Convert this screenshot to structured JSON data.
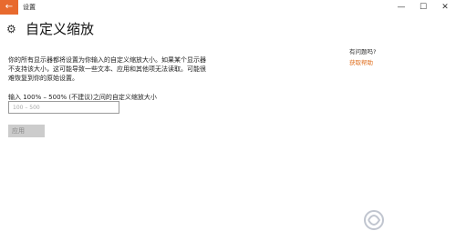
{
  "window": {
    "title": "设置",
    "back_glyph": "←",
    "controls": [
      "—",
      "☐",
      "✕"
    ]
  },
  "page": {
    "icon": "gear-icon",
    "title": "自定义缩放",
    "description": "你的所有显示器都将设置为你输入的自定义缩放大小。如果某个显示器不支持该大小，这可能导致一些文本、应用和其他项无法读取。可能很难恢复到你的原始设置。",
    "input_label": "输入 100% – 500% (不建议)之间的自定义缩放大小",
    "input_placeholder": "100 – 500",
    "input_value": "",
    "apply_label": "应用"
  },
  "help": {
    "question": "有问题吗?",
    "link": "获取帮助"
  },
  "colors": {
    "accent": "#e86a2e",
    "link": "#e07020",
    "button_disabled": "#cccccc"
  }
}
